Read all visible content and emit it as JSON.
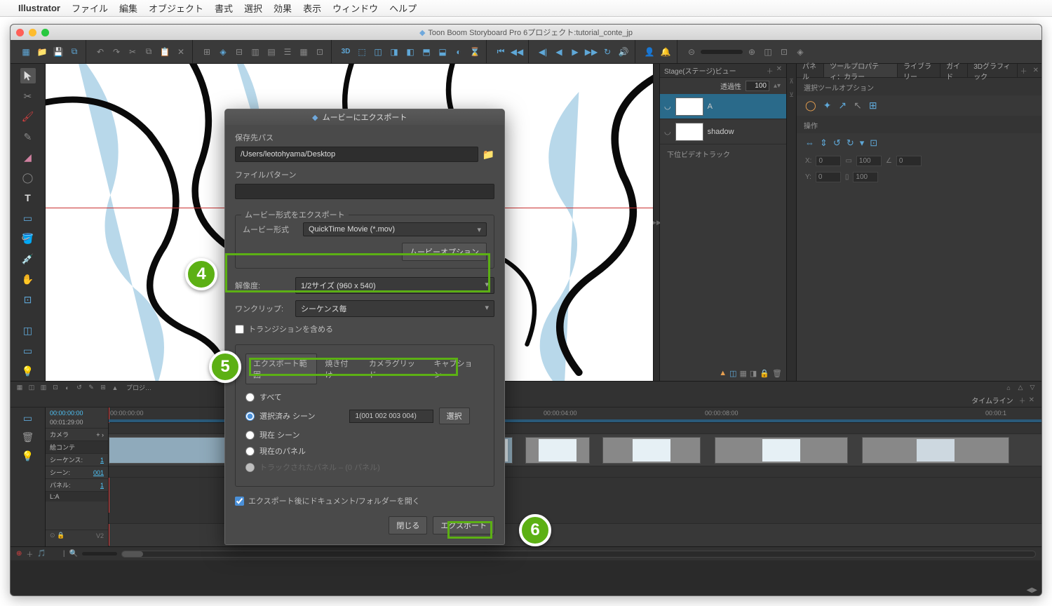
{
  "mac_menu": {
    "app": "Illustrator",
    "items": [
      "ファイル",
      "編集",
      "オブジェクト",
      "書式",
      "選択",
      "効果",
      "表示",
      "ウィンドウ",
      "ヘルプ"
    ]
  },
  "window_title": "Toon Boom Storyboard Pro 6プロジェクト:tutorial_conte_jp",
  "layers_panel": {
    "title": "Stage(ステージ)ビュー",
    "opacity_label": "透過性",
    "opacity_value": "100",
    "layers": [
      {
        "name": "A"
      },
      {
        "name": "shadow"
      }
    ],
    "sub": "下位ビデオトラック"
  },
  "right_panel": {
    "tabs": [
      "パネル",
      "ツールプロパティ：カラー",
      "ライブラリー",
      "ガイド",
      "3Dグラフィック"
    ],
    "sec1": "選択ツールオプション",
    "sec2": "操作",
    "x_label": "X:",
    "y_label": "Y:",
    "x_val": "0",
    "y_val": "0",
    "w_val": "100",
    "h_val": "100",
    "a_val": "0"
  },
  "timeline": {
    "title": "タイムライン",
    "tc1": "00:00:00:00",
    "tc2": "00:01:29:00",
    "camera": "カメラ",
    "storyboard": "絵コンテ",
    "seq_label": "シーケンス:",
    "seq_val": "1",
    "scene_label": "シーン:",
    "scene_val": "001",
    "panel_label": "パネル:",
    "panel_val": "1",
    "la": "L:A",
    "v2": "V2",
    "ticks": [
      "00:00:00:00",
      "00:00:04:00",
      "00:00:08:00",
      "00:00:1"
    ]
  },
  "modal": {
    "title": "ムービーにエクスポート",
    "save_path_label": "保存先パス",
    "save_path_value": "/Users/leotohyama/Desktop",
    "file_pattern_label": "ファイルパターン",
    "file_pattern_value": "",
    "section_format": "ムービー形式をエクスポート",
    "format_label": "ムービー形式",
    "format_value": "QuickTime Movie (*.mov)",
    "movie_options": "ムービーオプション",
    "resolution_label": "解像度:",
    "resolution_value": "1/2サイズ (960 x 540)",
    "oneclip_label": "ワンクリップ:",
    "oneclip_value": "シーケンス毎",
    "include_transitions": "トランジションを含める",
    "tabs": [
      "エクスポート範囲",
      "焼き付け",
      "カメラグリッド",
      "キャプション"
    ],
    "radio_all": "すべて",
    "radio_selected": "選択済み シーン",
    "radio_current_scene": "現在 シーン",
    "radio_current_panel": "現在のパネル",
    "radio_tracked": "トラックされたパネル – (0 パネル)",
    "scene_list": "1(001 002 003 004)",
    "select_btn": "選択",
    "open_after": "エクスポート後にドキュメント/フォルダーを開く",
    "close_btn": "閉じる",
    "export_btn": "エクスポート"
  },
  "badges": {
    "b4": "4",
    "b5": "5",
    "b6": "6"
  }
}
